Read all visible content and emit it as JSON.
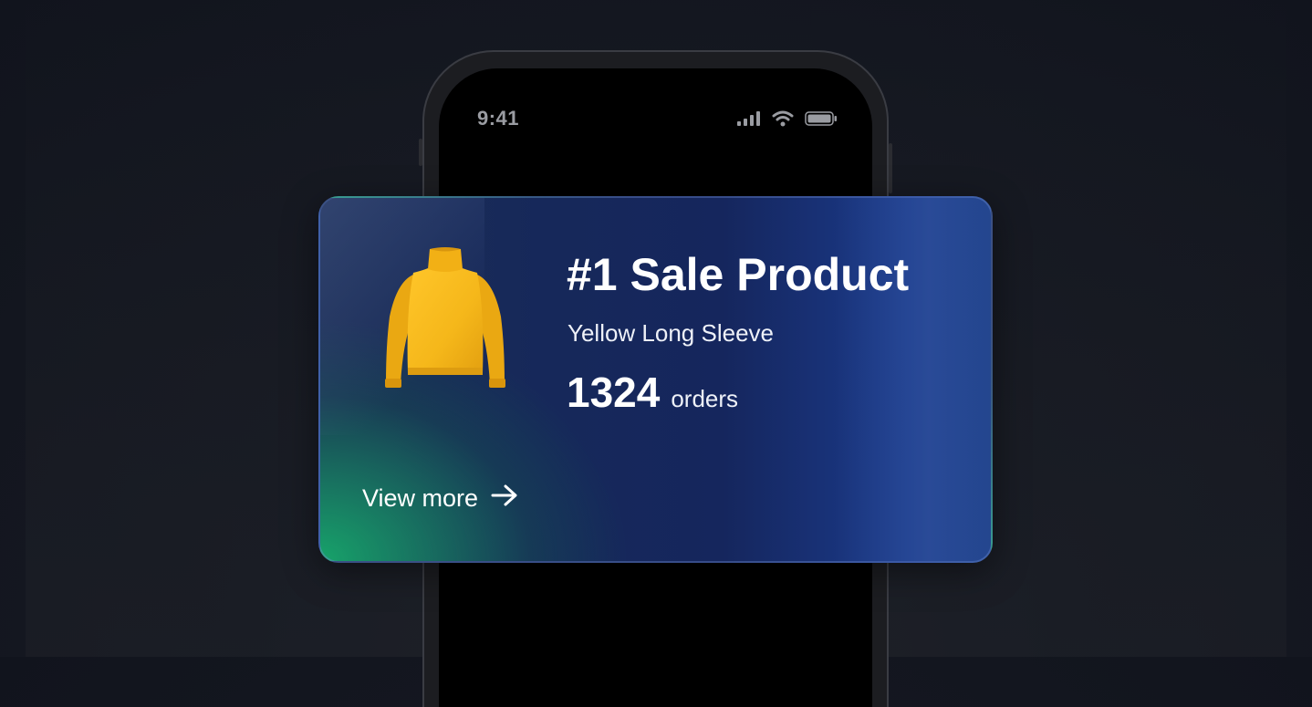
{
  "status_bar": {
    "time": "9:41",
    "icons": [
      "signal-icon",
      "wifi-icon",
      "battery-icon"
    ]
  },
  "card": {
    "title": "#1 Sale Product",
    "product_name": "Yellow Long Sleeve",
    "orders_count": "1324",
    "orders_label": "orders",
    "link_label": "View more",
    "link_icon": "arrow-right-icon",
    "product_image": "yellow-turtleneck-sweater",
    "colors": {
      "gradient_green": "#17a36a",
      "gradient_navy": "#16285a",
      "gradient_blue": "#22468f",
      "sweater_yellow": "#f5b71a"
    }
  }
}
